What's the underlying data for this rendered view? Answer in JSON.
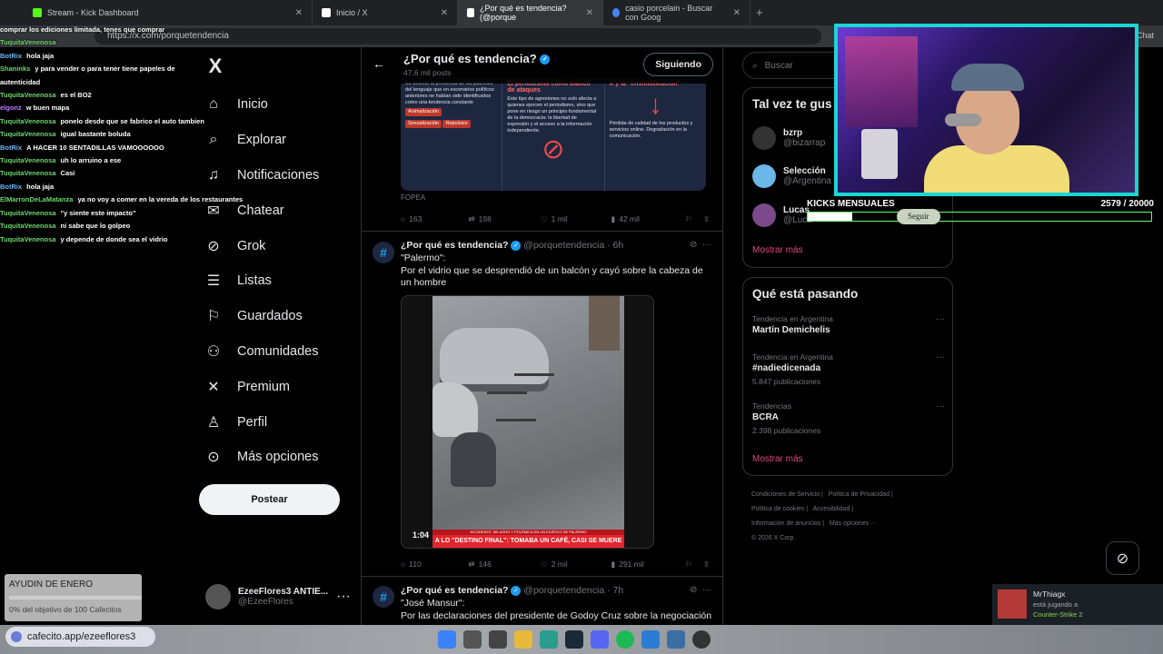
{
  "browser": {
    "tabs": [
      {
        "label": "Stream - Kick Dashboard",
        "icon": "kick-icon"
      },
      {
        "label": "Inicio / X",
        "icon": "x-logo-icon"
      },
      {
        "label": "¿Por qué es tendencia? (@porque",
        "icon": "x-logo-icon"
      },
      {
        "label": "casio porcelain - Buscar con Goog",
        "icon": "google-icon"
      }
    ],
    "url": "https://x.com/porquetendencia",
    "chat_label": "Chat"
  },
  "stream_chat": [
    {
      "user": "",
      "msg": "comprar los ediciones limitada, tenes que comprar"
    },
    {
      "user": "TuquitaVenenosa",
      "msg": ""
    },
    {
      "user": "BotRix",
      "msg": "hola jaja"
    },
    {
      "user": "Shaninks",
      "msg": "y para vender o para tener tiene papeles de"
    },
    {
      "user": "",
      "msg": "autenticidad"
    },
    {
      "user": "TuquitaVenenosa",
      "msg": "es el BO2"
    },
    {
      "user": "elgonz",
      "msg": "w buen mapa"
    },
    {
      "user": "TuquitaVenenosa",
      "msg": "ponelo desde que se fabrico el auto tambien"
    },
    {
      "user": "TuquitaVenenosa",
      "msg": "igual bastante boluda"
    },
    {
      "user": "BotRix",
      "msg": "A HACER 10 SENTADILLAS VAMOOOOOO"
    },
    {
      "user": "TuquitaVenenosa",
      "msg": "uh lo arruino a ese"
    },
    {
      "user": "TuquitaVenenosa",
      "msg": "Casi"
    },
    {
      "user": "BotRix",
      "msg": "hola jaja"
    },
    {
      "user": "ElMarronDeLaMatanza",
      "msg": "ya no voy a comer en la vereda de los restaurantes"
    },
    {
      "user": "TuquitaVenenosa",
      "msg": "\"y siente este impacto\""
    },
    {
      "user": "TuquitaVenenosa",
      "msg": "ni sabe que lo golpeo"
    },
    {
      "user": "TuquitaVenenosa",
      "msg": "y depende de donde sea el vidrio"
    }
  ],
  "nav": {
    "logo": "X",
    "items": [
      {
        "label": "Inicio",
        "icon": "home-icon"
      },
      {
        "label": "Explorar",
        "icon": "search-icon"
      },
      {
        "label": "Notificaciones",
        "icon": "bell-icon"
      },
      {
        "label": "Chatear",
        "icon": "mail-icon"
      },
      {
        "label": "Grok",
        "icon": "grok-icon"
      },
      {
        "label": "Listas",
        "icon": "list-icon"
      },
      {
        "label": "Guardados",
        "icon": "bookmark-icon"
      },
      {
        "label": "Comunidades",
        "icon": "communities-icon"
      },
      {
        "label": "Premium",
        "icon": "x-logo-icon"
      },
      {
        "label": "Perfil",
        "icon": "person-icon"
      },
      {
        "label": "Más opciones",
        "icon": "more-circle-icon"
      }
    ],
    "post_button": "Postear",
    "account": {
      "name": "EzeeFlores3 ANTIE...",
      "handle": "@EzeeFlores"
    }
  },
  "profile_header": {
    "title": "¿Por qué es tendencia?",
    "subtitle": "47,6 mil posts",
    "follow_label": "Siguiendo"
  },
  "infographic": {
    "col1_lines": "Se detectó la presencia de los patrones del lenguaje que en escenarios políticos anteriores ne habían sido identificados como una tendencia constante",
    "col1_badges": [
      "Animalización",
      "Sexualización",
      "Repulsivo"
    ],
    "col2_title": "El periodismo como blanco de ataques",
    "col2_text": "Este tipo de agresiones no solo afecta a quienes ejercen el periodismo, sino que pone en riesgo un principio fundamental de la democracia: la libertad de expresión y el acceso a la información independiente.",
    "col3_title": "X y la \"enshittificación\"",
    "col3_text": "Pérdida de calidad de los productos y servicios online. Degradación en la comunicación.",
    "footer_tag": "FOPEA"
  },
  "tweet1_stats": {
    "replies": "163",
    "retweets": "198",
    "likes": "1 mil",
    "views": "42 mil"
  },
  "tweet2": {
    "name": "¿Por qué es tendencia?",
    "meta": "@porquetendencia · 6h",
    "text1": "\"Palermo\":",
    "text2": "Por el vidrio que se desprendió de un balcón y cayó sobre la cabeza de un hombre",
    "video_time": "1:04",
    "banner_top": "ACCIDENTE, MILAGRO Y POLÉMICA EN UN EDIFICIO DE PALERMO",
    "banner": "A LO \"DESTINO FINAL\": TOMABA UN CAFÉ, CASI SE MUERE",
    "stats": {
      "replies": "110",
      "retweets": "146",
      "likes": "2 mil",
      "views": "291 mil"
    }
  },
  "tweet3": {
    "name": "¿Por qué es tendencia?",
    "meta": "@porquetendencia · 7h",
    "text1": "\"José Mansur\":",
    "text2": "Por las declaraciones del presidente de Godoy Cruz sobre la negociación"
  },
  "right": {
    "search_placeholder": "Buscar",
    "who_title": "Tal vez te gus",
    "who": [
      {
        "name": "bzrp",
        "handle": "@bizarrap"
      },
      {
        "name": "Selección",
        "handle": "@Argentina"
      },
      {
        "name": "Lucas",
        "handle": "@Luca"
      }
    ],
    "show_more": "Mostrar más",
    "trending_title": "Qué está pasando",
    "trends": [
      {
        "ctx": "Tendencia en Argentina",
        "title": "Martín Demichelis",
        "count": ""
      },
      {
        "ctx": "Tendencia en Argentina",
        "title": "#nadiedicenada",
        "count": "5.847 publicaciones"
      },
      {
        "ctx": "Tendencias",
        "title": "BCRA",
        "count": "2.398 publicaciones"
      }
    ],
    "show_more2": "Mostrar más",
    "footer": [
      "Condiciones de Servicio |",
      "Política de Privacidad |",
      "Política de cookies |",
      "Accesibilidad |",
      "Información de anuncios |",
      "Más opciones ···",
      "© 2026 X Corp."
    ]
  },
  "overlay": {
    "kicks_label": "KICKS MENSUALES",
    "kicks_count": "2579  / 20000",
    "kicks_fraction": 0.129,
    "seguir": "Seguir",
    "goal_title": "AYUDIN DE ENERO",
    "goal_sub": "0% del objetivo de 100 Cafecitos",
    "goal_fraction": 0.0,
    "cafecito": "cafecito.app/ezeeflores3",
    "steam_name": "MrThiagx",
    "steam_playing": "está jugando a",
    "steam_game": "Counter-Strike 2"
  },
  "colors": {
    "accent": "#1d9bf0",
    "pink": "#e8477e",
    "cam_border": "#19d6d3"
  }
}
